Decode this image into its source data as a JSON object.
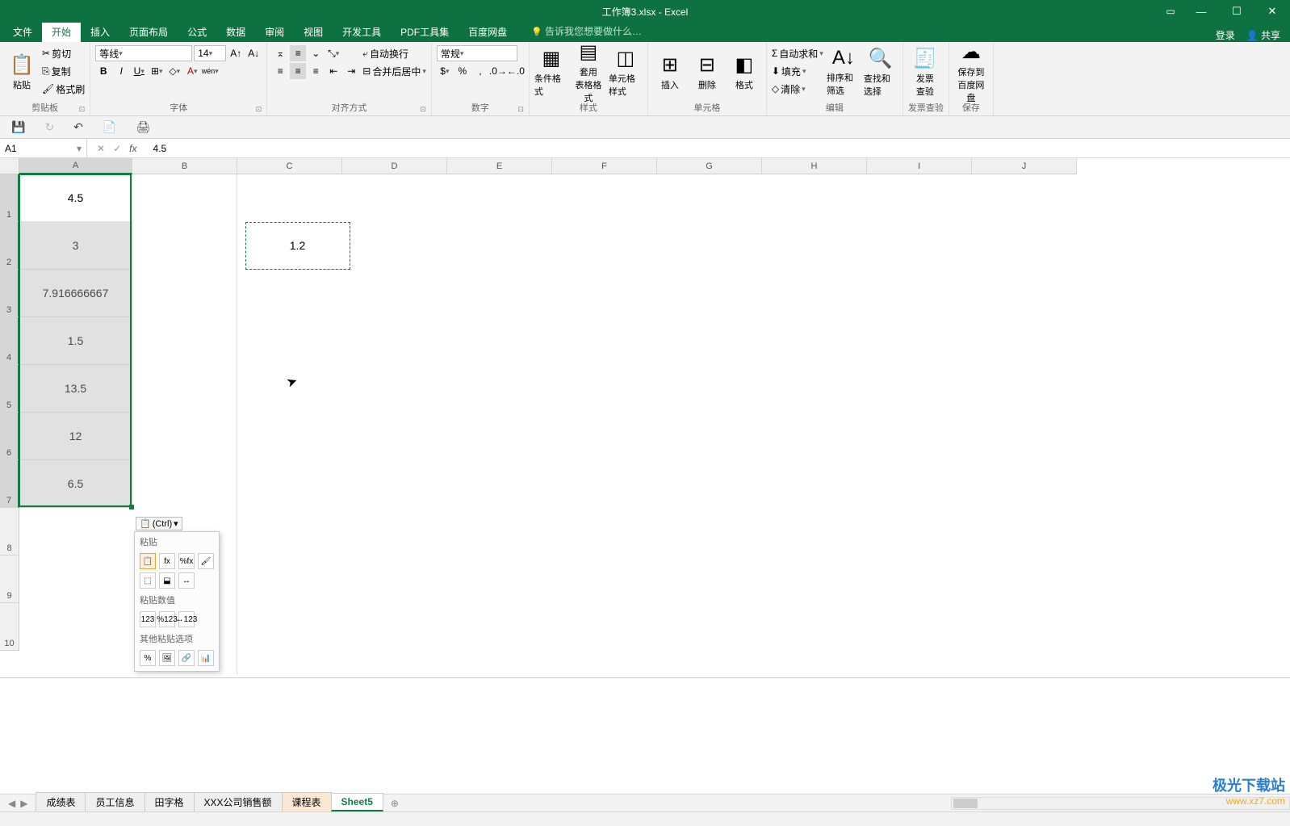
{
  "title": {
    "filename": "工作簿3.xlsx",
    "app": "Excel",
    "sep": " - "
  },
  "window_controls": {
    "ribbon_opts": "▭",
    "minimize": "—",
    "maximize": "☐",
    "close": "✕"
  },
  "tabs": {
    "file": "文件",
    "home": "开始",
    "insert": "插入",
    "layout": "页面布局",
    "formulas": "公式",
    "data": "数据",
    "review": "审阅",
    "view": "视图",
    "developer": "开发工具",
    "pdf": "PDF工具集",
    "baidu": "百度网盘",
    "tell_me": "告诉我您想要做什么…",
    "login": "登录",
    "share": "共享"
  },
  "ribbon": {
    "clipboard": {
      "paste": "粘贴",
      "cut": "剪切",
      "copy": "复制",
      "format_painter": "格式刷",
      "label": "剪贴板"
    },
    "font": {
      "name": "等线",
      "size": "14",
      "bold": "B",
      "italic": "I",
      "underline": "U",
      "label": "字体",
      "phonetic": "wén"
    },
    "alignment": {
      "wrap": "自动换行",
      "merge": "合并后居中",
      "label": "对齐方式"
    },
    "number": {
      "format": "常规",
      "label": "数字"
    },
    "styles": {
      "cond": "条件格式",
      "table": "套用\n表格格式",
      "cell": "单元格样式",
      "label": "样式"
    },
    "cells": {
      "insert": "插入",
      "delete": "删除",
      "format": "格式",
      "label": "单元格"
    },
    "editing": {
      "sum": "自动求和",
      "fill": "填充",
      "clear": "清除",
      "sort": "排序和筛选",
      "find": "查找和选择",
      "label": "编辑"
    },
    "invoice": {
      "check": "发票\n查验",
      "label": "发票查验"
    },
    "save_cloud": {
      "btn": "保存到\n百度网盘",
      "label": "保存"
    }
  },
  "qat": {
    "save": "💾",
    "redo": "↻",
    "undo": "↶",
    "touch": "📄",
    "mode": "🖨"
  },
  "formula_bar": {
    "name_box": "A1",
    "cancel": "✕",
    "enter": "✓",
    "fx": "fx",
    "value": "4.5"
  },
  "columns": [
    "A",
    "B",
    "C",
    "D",
    "E",
    "F",
    "G",
    "H",
    "I",
    "J"
  ],
  "rows": [
    "1",
    "2",
    "3",
    "4",
    "5",
    "6",
    "7",
    "8",
    "9",
    "10"
  ],
  "cells": {
    "A1": "4.5",
    "A2": "3",
    "A3": "7.916666667",
    "A4": "1.5",
    "A5": "13.5",
    "A6": "12",
    "A7": "6.5",
    "C2": "1.2"
  },
  "paste_options": {
    "ctrl_label": "(Ctrl)",
    "section1": "粘贴",
    "section2": "粘贴数值",
    "section3": "其他粘贴选项",
    "opts1": [
      "📋",
      "fx",
      "%fx",
      "🖌"
    ],
    "opts1b": [
      "⬚",
      "⬓",
      "↔"
    ],
    "opts2": [
      "123",
      "%123",
      "↔123"
    ],
    "opts3": [
      "%",
      "🖼",
      "🔗",
      "📊"
    ]
  },
  "sheets": {
    "nav_prev": "◀",
    "nav_next": "▶",
    "list": [
      {
        "name": "成绩表",
        "cls": ""
      },
      {
        "name": "员工信息",
        "cls": ""
      },
      {
        "name": "田字格",
        "cls": ""
      },
      {
        "name": "XXX公司销售额",
        "cls": ""
      },
      {
        "name": "课程表",
        "cls": "orange"
      },
      {
        "name": "Sheet5",
        "cls": "active"
      }
    ],
    "add": "⊕"
  },
  "watermark": {
    "line1": "极光下载站",
    "line2": "www.xz7.com"
  }
}
